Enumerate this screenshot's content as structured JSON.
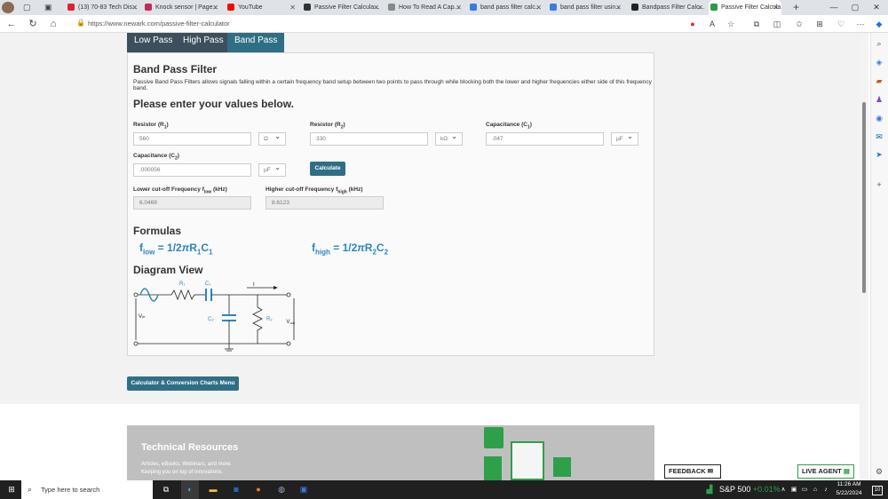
{
  "browser": {
    "tabs": [
      {
        "title": "(13) 70-83 Tech Dis...",
        "fav": "#d23"
      },
      {
        "title": "Knock sensor | Page...",
        "fav": "#c8275a"
      },
      {
        "title": "YouTube",
        "fav": "#f00"
      },
      {
        "title": "Passive Filter Calcula...",
        "fav": "#333"
      },
      {
        "title": "How To Read A Cap...",
        "fav": "#888"
      },
      {
        "title": "band pass filter calc...",
        "fav": "#3b7be0"
      },
      {
        "title": "band pass filter usin...",
        "fav": "#3b7be0"
      },
      {
        "title": "Bandpass Filter Calc...",
        "fav": "#222"
      },
      {
        "title": "Passive Filter Calcula...",
        "fav": "#2b9a4a"
      }
    ],
    "url": "https://www.newark.com/passive-filter-calculator"
  },
  "filter_tabs": [
    "Low Pass",
    "High Pass",
    "Band Pass"
  ],
  "panel": {
    "title": "Band Pass Filter",
    "desc": "Passive Band Pass Filters allows signals falling within a certain frequency band setup between two points to pass through while blocking both the lower and higher frequencies either side of this frequency band.",
    "enter": "Please enter your values below.",
    "r1_label": "Resistor (R",
    "r1_sub": "1",
    "r1_value": "560",
    "r1_unit": "Ω",
    "r2_label": "Resistor (R",
    "r2_sub": "2",
    "r2_value": "330",
    "r2_unit": "kΩ",
    "c1_label": "Capacitance (C",
    "c1_sub": "1",
    "c1_value": ".047",
    "c1_unit": "µF",
    "c2_label": "Capacitance (C",
    "c2_sub": "2",
    "c2_value": ".000056",
    "c2_unit": "µF",
    "calc": "Calculate",
    "flow_label": "Lower cut-off Frequency f",
    "flow_sub": "low",
    "flow_unit": " (kHz)",
    "flow_value": "6.0469",
    "fhigh_label": "Higher cut-off Frequency f",
    "fhigh_sub": "high",
    "fhigh_unit": " (kHz)",
    "fhigh_value": "8.6123",
    "formulas_title": "Formulas",
    "diagram_title": "Diagram View",
    "diagram": {
      "r1": "R₁",
      "c1": "C₁",
      "c2": "C₂",
      "r2": "R₂",
      "i": "I",
      "vin": "Vᵢₙ",
      "vout": "V",
      "vout_sub": "out"
    }
  },
  "menu_button": "Calculator & Conversion Charts Menu",
  "tech": {
    "title": "Technical Resources",
    "line1": "Articles, eBooks, Webinars, and more.",
    "line2": "Keeping you on top of innovations."
  },
  "feedback": "FEEDBACK",
  "live_agent": "LIVE AGENT",
  "taskbar": {
    "search": "Type here to search",
    "stock": "S&P 500",
    "change": "+0.01%",
    "time": "11:26 AM",
    "date": "5/22/2024",
    "notif": "10"
  }
}
